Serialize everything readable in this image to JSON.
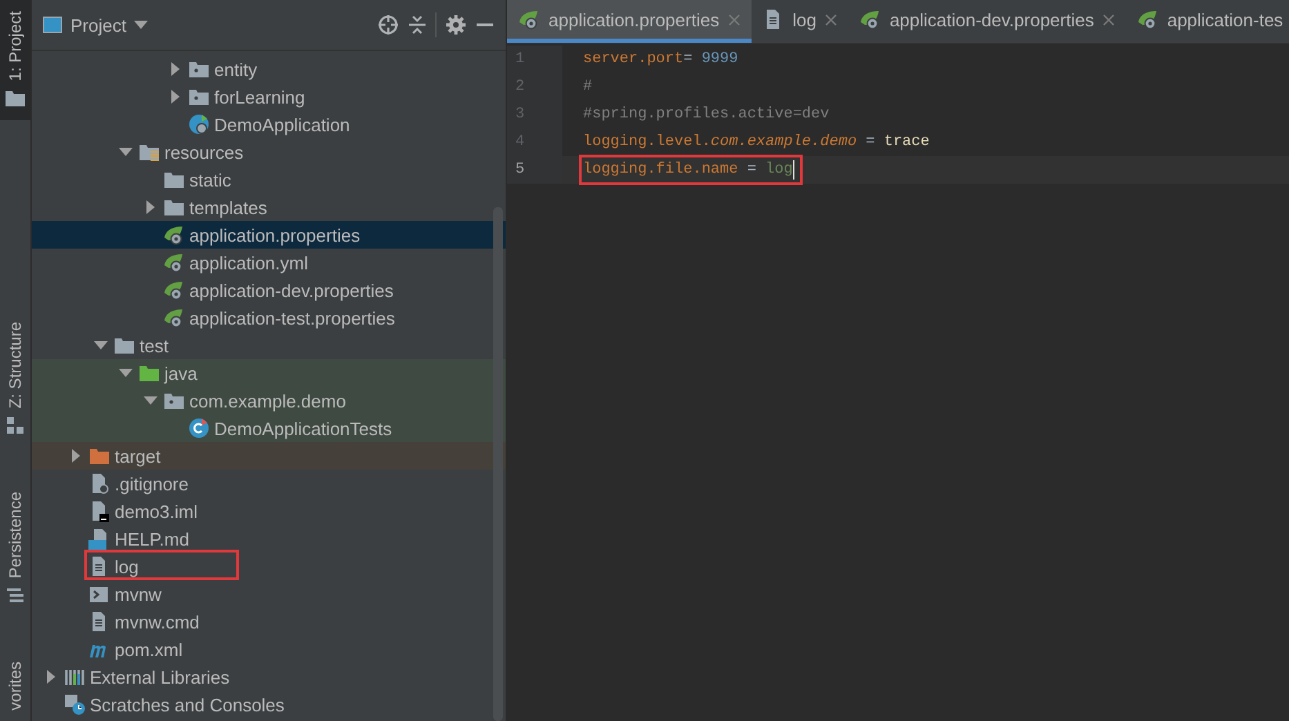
{
  "tool_strip": {
    "top": [
      {
        "label": "1: Project",
        "kind": "folder",
        "selected": true
      }
    ],
    "bottom": [
      {
        "label": "Z: Structure",
        "kind": "structure",
        "selected": false
      },
      {
        "label": "Persistence",
        "kind": "persistence",
        "selected": false
      },
      {
        "label": "vorites",
        "selected": false
      }
    ]
  },
  "project_panel": {
    "title": "Project",
    "tree": [
      {
        "children": [
          {
            "children": [
              {
                "children": [
                  {
                    "children": [
                      {
                        "children": [
                          {
                            "label": "entity",
                            "kind": "package",
                            "expanded": false,
                            "selected": false
                          },
                          {
                            "label": "forLearning",
                            "kind": "package",
                            "expanded": false,
                            "selected": false
                          },
                          {
                            "label": "DemoApplication",
                            "kind": "spring-class",
                            "selected": false
                          }
                        ]
                      }
                    ]
                  },
                  {
                    "label": "resources",
                    "kind": "resources-folder",
                    "expanded": true,
                    "selected": false,
                    "children": [
                      {
                        "label": "static",
                        "kind": "folder",
                        "selected": false
                      },
                      {
                        "label": "templates",
                        "kind": "folder",
                        "expanded": false,
                        "selected": false
                      },
                      {
                        "label": "application.properties",
                        "kind": "spring-config",
                        "selected": true
                      },
                      {
                        "label": "application.yml",
                        "kind": "spring-config",
                        "selected": false
                      },
                      {
                        "label": "application-dev.properties",
                        "kind": "spring-config",
                        "selected": false
                      },
                      {
                        "label": "application-test.properties",
                        "kind": "spring-config",
                        "selected": false
                      }
                    ]
                  }
                ]
              },
              {
                "label": "test",
                "kind": "folder",
                "expanded": true,
                "selected": false,
                "children": [
                  {
                    "label": "java",
                    "kind": "test-folder",
                    "expanded": true,
                    "selected": false,
                    "color": "#3f4a42",
                    "children": [
                      {
                        "label": "com.example.demo",
                        "kind": "package",
                        "expanded": true,
                        "selected": false,
                        "color": "#3f4a42",
                        "children": [
                          {
                            "label": "DemoApplicationTests",
                            "kind": "test-class",
                            "selected": false,
                            "color": "#3f4a42"
                          }
                        ]
                      }
                    ]
                  }
                ]
              }
            ]
          },
          {
            "label": "target",
            "kind": "excluded-folder",
            "expanded": false,
            "selected": false,
            "color": "#45403a"
          },
          {
            "label": ".gitignore",
            "kind": "file-ignore",
            "selected": false
          },
          {
            "label": "demo3.iml",
            "kind": "file-iml",
            "selected": false
          },
          {
            "label": "HELP.md",
            "kind": "file-md",
            "selected": false
          },
          {
            "label": "log",
            "kind": "file-text",
            "selected": false,
            "boxed": true
          },
          {
            "label": "mvnw",
            "kind": "file-shell",
            "selected": false
          },
          {
            "label": "mvnw.cmd",
            "kind": "file-text",
            "selected": false
          },
          {
            "label": "pom.xml",
            "kind": "maven",
            "selected": false
          }
        ]
      },
      {
        "label": "External Libraries",
        "kind": "libraries",
        "expanded": false,
        "selected": false
      },
      {
        "label": "Scratches and Consoles",
        "kind": "scratches",
        "selected": false
      }
    ]
  },
  "editor": {
    "tabs": [
      {
        "label": "application.properties",
        "kind": "spring-config",
        "selected": true,
        "closable": true
      },
      {
        "label": "log",
        "kind": "file-text",
        "selected": false,
        "closable": true
      },
      {
        "label": "application-dev.properties",
        "kind": "spring-config",
        "selected": false,
        "closable": true
      },
      {
        "label": "application-tes",
        "kind": "spring-config",
        "selected": false,
        "closable": false
      }
    ],
    "lines": [
      {
        "number": "1",
        "current": false,
        "boxed": false,
        "segments": [
          {
            "kind": "key",
            "text": "server.port"
          },
          {
            "kind": "operator",
            "text": "= "
          },
          {
            "kind": "number",
            "text": "9999"
          }
        ]
      },
      {
        "number": "2",
        "current": false,
        "boxed": false,
        "segments": [
          {
            "kind": "comment",
            "text": "#"
          }
        ]
      },
      {
        "number": "3",
        "current": false,
        "boxed": false,
        "segments": [
          {
            "kind": "comment",
            "text": "#spring.profiles.active=dev"
          }
        ]
      },
      {
        "number": "4",
        "current": false,
        "boxed": false,
        "segments": [
          {
            "kind": "key",
            "text": "logging.level."
          },
          {
            "kind": "key-italic",
            "text": "com.example.demo"
          },
          {
            "kind": "operator",
            "text": " = "
          },
          {
            "kind": "value",
            "text": "trace"
          }
        ]
      },
      {
        "number": "5",
        "current": true,
        "boxed": true,
        "segments": [
          {
            "kind": "key",
            "text": "logging.file.name"
          },
          {
            "kind": "operator",
            "text": " = "
          },
          {
            "kind": "string",
            "text": "log"
          }
        ]
      }
    ]
  }
}
